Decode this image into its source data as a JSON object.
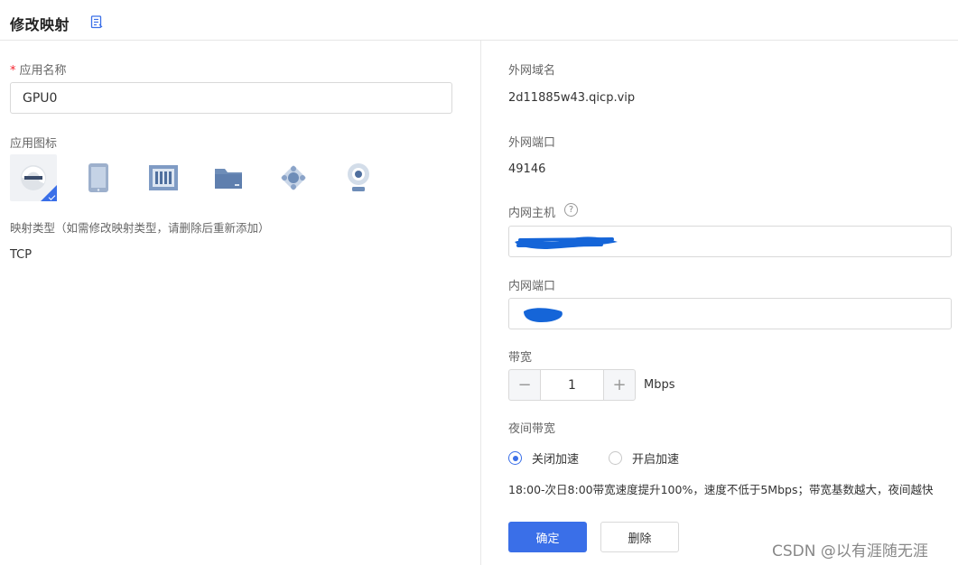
{
  "header": {
    "title": "修改映射",
    "doc_icon": "document-icon"
  },
  "left": {
    "app_name": {
      "required_mark": "*",
      "label": "应用名称",
      "value": "GPU0"
    },
    "app_icon": {
      "label": "应用图标",
      "icons": [
        "browser-e-icon",
        "tablet-icon",
        "server-rack-icon",
        "folder-icon",
        "network-node-icon",
        "webcam-icon"
      ],
      "selected_index": 0
    },
    "mapping_type": {
      "label": "映射类型（如需修改映射类型，请删除后重新添加）",
      "value": "TCP"
    }
  },
  "right": {
    "external_domain": {
      "label": "外网域名",
      "value": "2d11885w43.qicp.vip"
    },
    "external_port": {
      "label": "外网端口",
      "value": "49146"
    },
    "internal_host": {
      "label": "内网主机",
      "help_icon": "?"
    },
    "internal_port": {
      "label": "内网端口"
    },
    "bandwidth": {
      "label": "带宽",
      "minus": "−",
      "value": "1",
      "plus": "+",
      "unit": "Mbps"
    },
    "night_bandwidth": {
      "label": "夜间带宽",
      "options": [
        "关闭加速",
        "开启加速"
      ],
      "selected": "关闭加速",
      "note": "18:00-次日8:00带宽速度提升100%，速度不低于5Mbps；带宽基数越大，夜间越快"
    },
    "actions": {
      "confirm": "确定",
      "delete": "删除"
    }
  },
  "colors": {
    "accent": "#3a6fe8",
    "required": "#f5222d",
    "scribble": "#1565d8"
  },
  "watermark": "CSDN @以有涯随无涯"
}
